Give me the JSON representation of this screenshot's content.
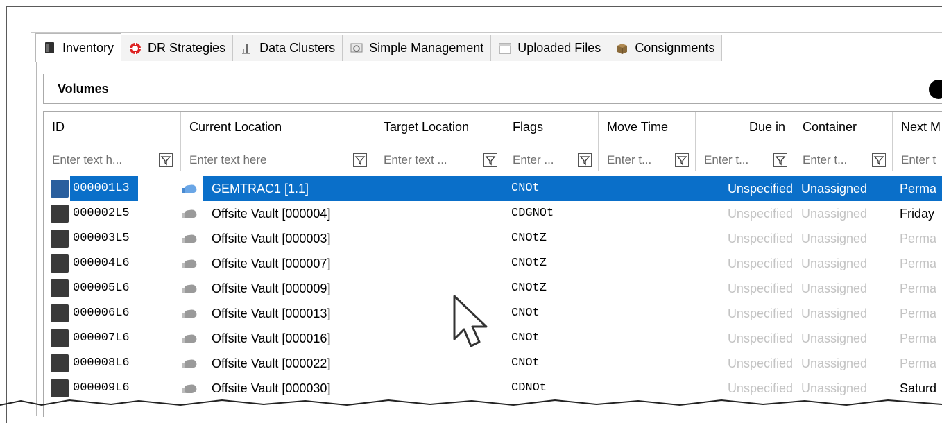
{
  "tabs": [
    {
      "label": "Inventory",
      "icon": "book-icon",
      "active": true
    },
    {
      "label": "DR Strategies",
      "icon": "lifebuoy-icon",
      "active": false
    },
    {
      "label": "Data Clusters",
      "icon": "cluster-icon",
      "active": false
    },
    {
      "label": "Simple Management",
      "icon": "monitor-icon",
      "active": false
    },
    {
      "label": "Uploaded Files",
      "icon": "window-icon",
      "active": false
    },
    {
      "label": "Consignments",
      "icon": "box-icon",
      "active": false
    }
  ],
  "section": {
    "title": "Volumes"
  },
  "columns": [
    {
      "title": "ID",
      "placeholder": "Enter text h..."
    },
    {
      "title": "Current Location",
      "placeholder": "Enter text here"
    },
    {
      "title": "Target Location",
      "placeholder": "Enter text ..."
    },
    {
      "title": "Flags",
      "placeholder": "Enter ..."
    },
    {
      "title": "Move Time",
      "placeholder": "Enter t..."
    },
    {
      "title": "Due in",
      "placeholder": "Enter t..."
    },
    {
      "title": "Container",
      "placeholder": "Enter t..."
    },
    {
      "title": "Next M",
      "placeholder": "Enter t"
    }
  ],
  "rows": [
    {
      "id": "000001L3",
      "location": "GEMTRAC1 [1.1]",
      "flags": "CNOt",
      "due": "Unspecified",
      "container": "Unassigned",
      "next": "Perma",
      "selected": true
    },
    {
      "id": "000002L5",
      "location": "Offsite Vault [000004]",
      "flags": "CDGNOt",
      "due": "Unspecified",
      "container": "Unassigned",
      "next": "Friday"
    },
    {
      "id": "000003L5",
      "location": "Offsite Vault [000003]",
      "flags": "CNOtZ",
      "due": "Unspecified",
      "container": "Unassigned",
      "next": "Perma"
    },
    {
      "id": "000004L6",
      "location": "Offsite Vault [000007]",
      "flags": "CNOtZ",
      "due": "Unspecified",
      "container": "Unassigned",
      "next": "Perma"
    },
    {
      "id": "000005L6",
      "location": "Offsite Vault [000009]",
      "flags": "CNOtZ",
      "due": "Unspecified",
      "container": "Unassigned",
      "next": "Perma"
    },
    {
      "id": "000006L6",
      "location": "Offsite Vault [000013]",
      "flags": "CNOt",
      "due": "Unspecified",
      "container": "Unassigned",
      "next": "Perma"
    },
    {
      "id": "000007L6",
      "location": "Offsite Vault [000016]",
      "flags": "CNOt",
      "due": "Unspecified",
      "container": "Unassigned",
      "next": "Perma"
    },
    {
      "id": "000008L6",
      "location": "Offsite Vault [000022]",
      "flags": "CNOt",
      "due": "Unspecified",
      "container": "Unassigned",
      "next": "Perma"
    },
    {
      "id": "000009L6",
      "location": "Offsite Vault [000030]",
      "flags": "CDNOt",
      "due": "Unspecified",
      "container": "Unassigned",
      "next": "Saturd"
    }
  ],
  "colors": {
    "selection": "#0a6fc9",
    "dim_text": "#c3c3c3"
  }
}
